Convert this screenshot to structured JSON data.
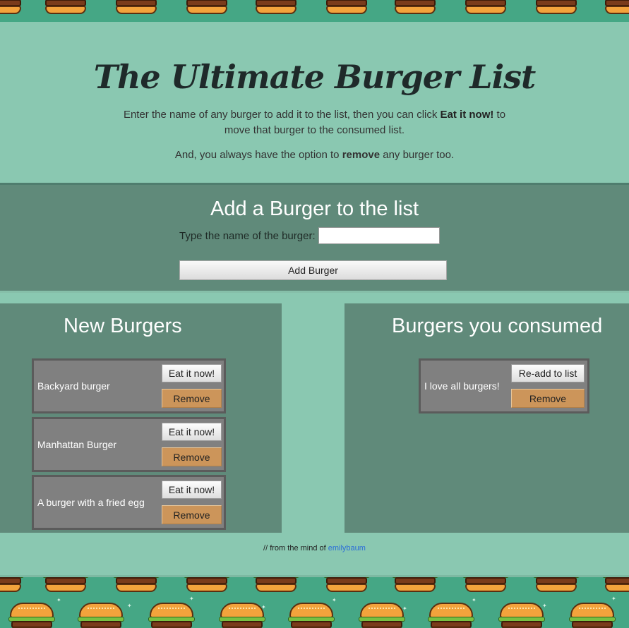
{
  "header": {
    "title": "The Ultimate Burger List",
    "intro_part1": "Enter the name of any burger to add it to the list, then you can click ",
    "intro_bold": "Eat it now!",
    "intro_part2": " to move that burger to the consumed list.",
    "intro2_part1": "And, you always have the option to ",
    "intro2_bold": "remove",
    "intro2_part2": " any burger too."
  },
  "add_form": {
    "heading": "Add a Burger to the list",
    "label": "Type the name of the burger:",
    "input_value": "",
    "button_label": "Add Burger"
  },
  "new_burgers": {
    "heading": "New Burgers",
    "items": [
      {
        "name": "Backyard burger",
        "eat_label": "Eat it now!",
        "remove_label": "Remove"
      },
      {
        "name": "Manhattan Burger",
        "eat_label": "Eat it now!",
        "remove_label": "Remove"
      },
      {
        "name": "A burger with a fried egg",
        "eat_label": "Eat it now!",
        "remove_label": "Remove"
      }
    ]
  },
  "consumed_burgers": {
    "heading": "Burgers you consumed",
    "items": [
      {
        "name": "I love all burgers!",
        "readd_label": "Re-add to list",
        "remove_label": "Remove"
      }
    ]
  },
  "footer": {
    "prefix": "// from the mind of ",
    "author_link": "emilybaum"
  },
  "colors": {
    "pattern_bg": "#45a785",
    "header_bg": "#8ac8b1",
    "panel_bg": "#608a7a",
    "card_bg": "#808080",
    "remove_button": "#cc955a",
    "link": "#2d6fd8"
  },
  "decor": {
    "pattern_icon": "burger-icon"
  }
}
